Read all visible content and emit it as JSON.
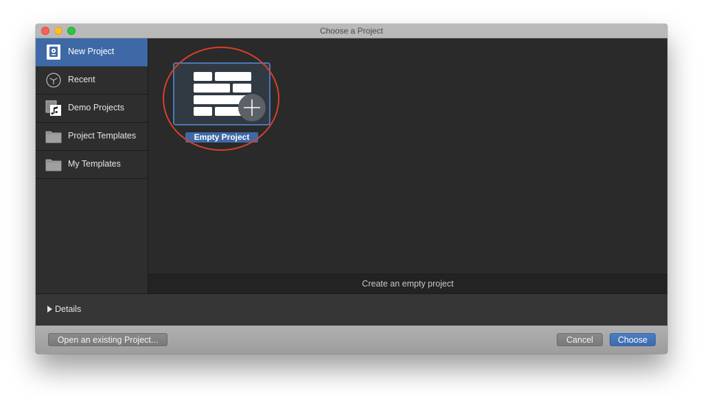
{
  "window": {
    "title": "Choose a Project",
    "traffic_lights": [
      "close",
      "minimize",
      "maximize"
    ]
  },
  "sidebar": {
    "items": [
      {
        "label": "New Project",
        "icon": "new-project-icon",
        "selected": true
      },
      {
        "label": "Recent",
        "icon": "clock-icon",
        "selected": false
      },
      {
        "label": "Demo Projects",
        "icon": "music-document-icon",
        "selected": false
      },
      {
        "label": "Project Templates",
        "icon": "folder-icon",
        "selected": false
      },
      {
        "label": "My Templates",
        "icon": "folder-icon",
        "selected": false
      }
    ]
  },
  "main": {
    "templates": [
      {
        "label": "Empty Project",
        "icon": "empty-project-grid-with-plus-icon",
        "selected": true
      }
    ],
    "description": "Create an empty project"
  },
  "details": {
    "label": "Details",
    "expanded": false
  },
  "footer": {
    "open_existing_label": "Open an existing Project...",
    "cancel_label": "Cancel",
    "choose_label": "Choose"
  },
  "colors": {
    "accent": "#3e69a6",
    "annotation_ring": "#d9412b",
    "window_bg": "#2b2b2b",
    "titlebar": "#b9b9b9"
  }
}
